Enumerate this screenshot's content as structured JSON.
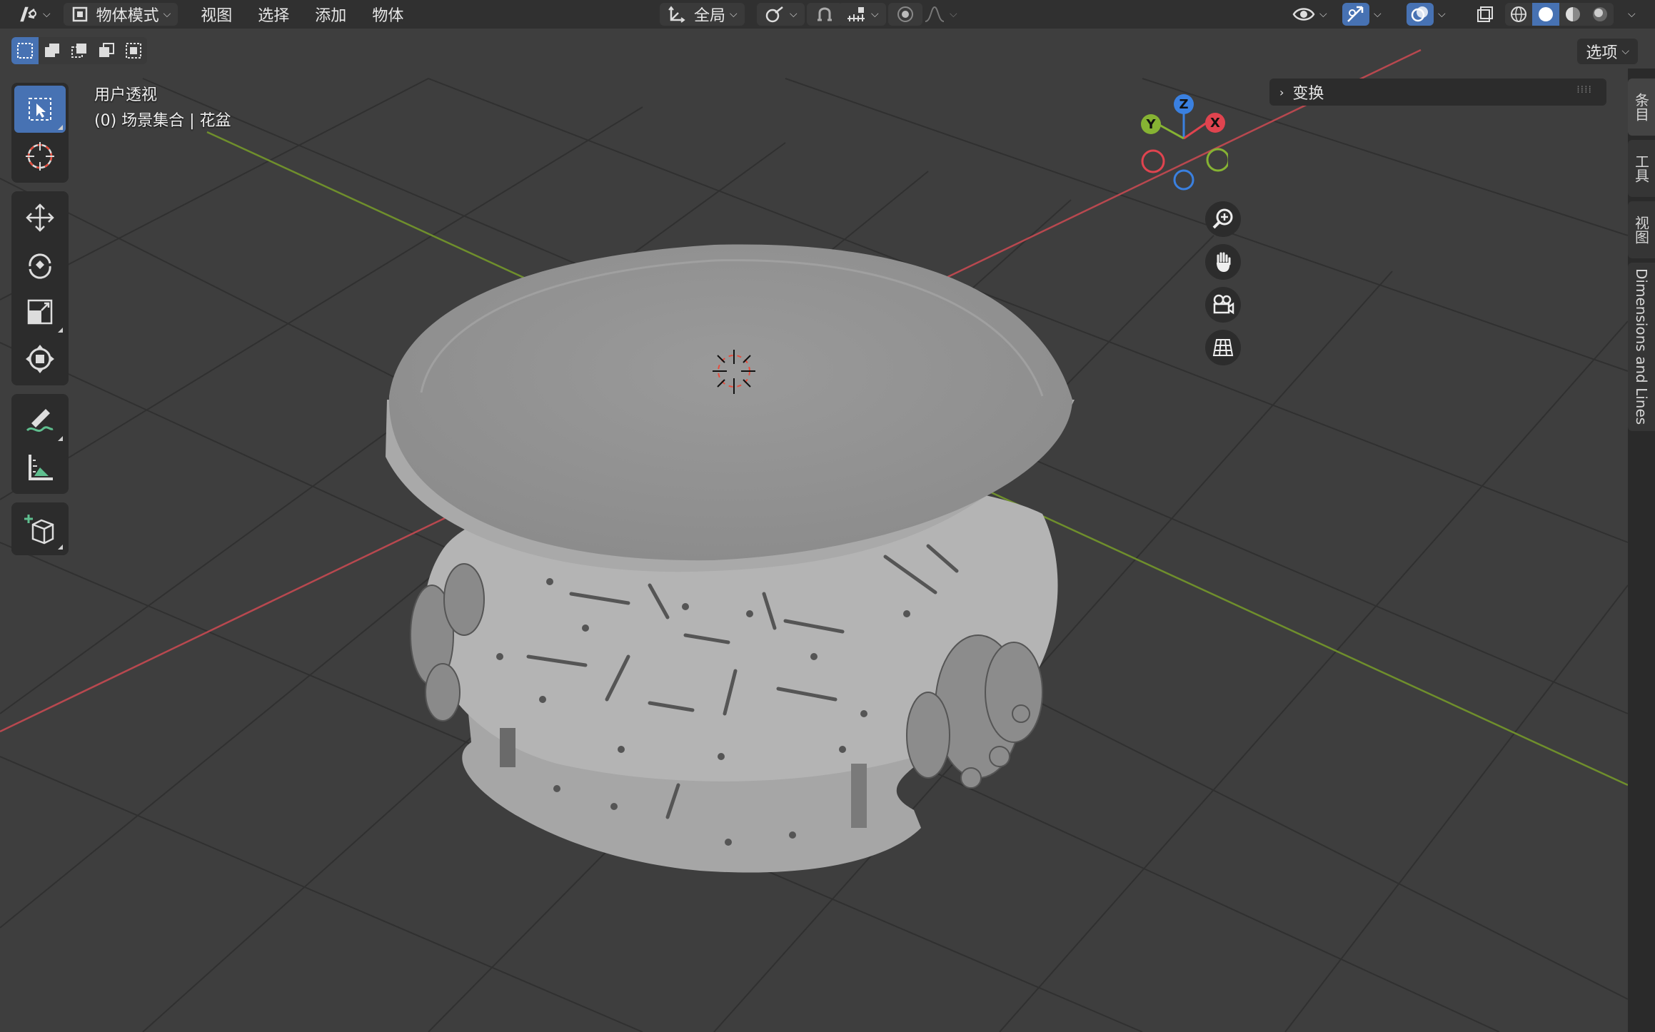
{
  "header": {
    "mode_label": "物体模式",
    "menus": [
      "视图",
      "选择",
      "添加",
      "物体"
    ],
    "transform_orientation": "全局",
    "icons": [
      "editor-type-icon",
      "object-mode-icon",
      "transform-orientation-icon",
      "pivot-icon",
      "snap-icon",
      "snap-increment-icon",
      "proportional-edit-icon",
      "falloff-icon",
      "visibility-icon",
      "gizmo-icon",
      "overlay-icon",
      "xray-icon",
      "wireframe-shading-icon",
      "solid-shading-icon",
      "material-shading-icon",
      "rendered-shading-icon"
    ]
  },
  "subbar": {
    "options_label": "选项"
  },
  "viewport": {
    "view_name": "用户透视",
    "collection_info": "(0) 场景集合 | 花盆"
  },
  "nav_gizmo": {
    "axes": {
      "x": "X",
      "y": "Y",
      "z": "Z"
    },
    "colors": {
      "x": "#e0444f",
      "y": "#86b333",
      "z": "#3a80e0"
    }
  },
  "npanel": {
    "section_label": "变换"
  },
  "sidetabs": {
    "items": [
      "条目",
      "工具",
      "视图",
      "Dimensions and Lines"
    ]
  },
  "toolbar": {
    "tools": [
      "select-box",
      "cursor",
      "move",
      "rotate",
      "scale",
      "transform",
      "annotate",
      "measure",
      "add-cube"
    ]
  }
}
